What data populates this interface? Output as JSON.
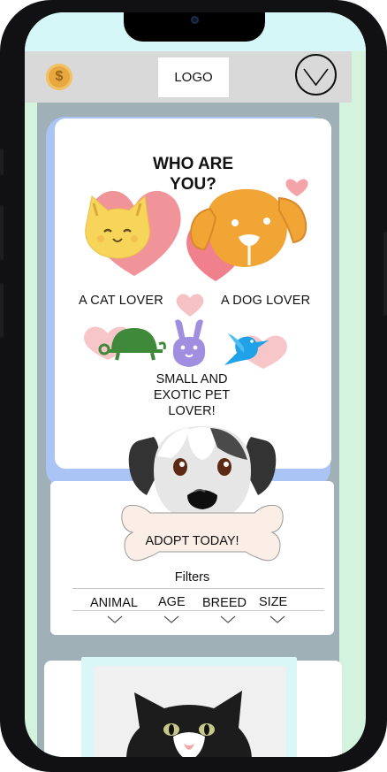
{
  "app": {
    "logo_text": "LOGO"
  },
  "hero": {
    "title_line1": "WHO ARE",
    "title_line2": "YOU?",
    "cat_label": "A CAT LOVER",
    "dog_label": "A DOG LOVER",
    "exotic_line1": "SMALL AND",
    "exotic_line2": "EXOTIC PET",
    "exotic_line3": "LOVER!"
  },
  "adopt": {
    "button_label": "ADOPT TODAY!"
  },
  "filters": {
    "label": "Filters",
    "items": [
      "ANIMAL",
      "AGE",
      "BREED",
      "SIZE"
    ]
  },
  "icons": {
    "coin": "coin-icon",
    "menu": "chevron-down-icon",
    "cat": "cat-icon",
    "dog": "dog-icon",
    "turtle": "turtle-icon",
    "rabbit": "rabbit-icon",
    "bird": "bird-icon",
    "heart": "heart-icon"
  },
  "colors": {
    "accent_blue": "#a9c4f5",
    "heart_pink": "#f4a3a8",
    "cat_yellow": "#f6d55a",
    "dog_orange": "#f0a535",
    "turtle_green": "#3f8a3a",
    "rabbit_purple": "#a08ee0",
    "bird_blue": "#1fa2e8",
    "header_gray": "#d9d9d9",
    "bone_cream": "#fbeee6"
  }
}
